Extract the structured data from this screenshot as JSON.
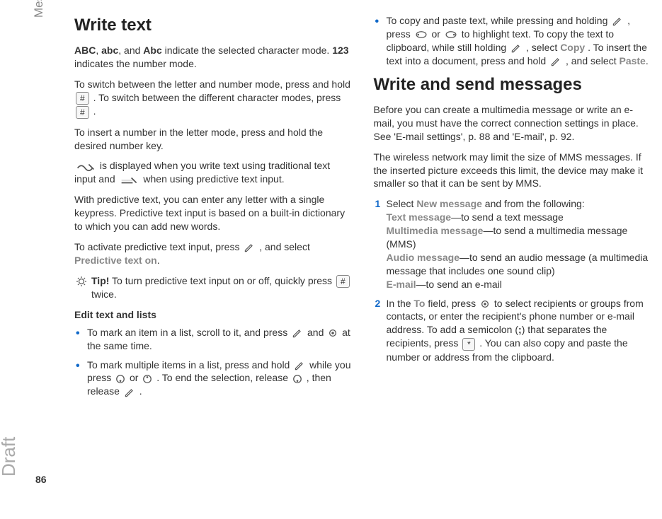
{
  "side": {
    "section": "Messaging",
    "watermark": "Draft",
    "page_number": "86"
  },
  "left": {
    "h1": "Write text",
    "p1_parts": {
      "abc_upper": "ABC",
      "sep1": ", ",
      "abc_lower": "abc",
      "sep2": ", and ",
      "abc_title": "Abc",
      "after": " indicate the selected character mode. ",
      "num": "123",
      "tail": " indicates the number mode."
    },
    "p2_before": "To switch between the letter and number mode, press and hold ",
    "p2_mid": ". To switch between the different character modes, press ",
    "p2_after": ".",
    "p3": "To insert a number in the letter mode, press and hold the desired number key.",
    "p4_before": " is displayed when you write text using traditional text input and ",
    "p4_after": " when using predictive text input.",
    "p5": "With predictive text, you can enter any letter with a single keypress. Predictive text input is based on a built-in dictionary to which you can add new words.",
    "p6_before": "To activate predictive text input, press ",
    "p6_mid": ", and select ",
    "p6_opt": "Predictive text on",
    "p6_after": ".",
    "tip_label": "Tip!",
    "tip_before": " To turn predictive text input on or off, quickly press ",
    "tip_after": " twice.",
    "subhead": "Edit text and lists",
    "b1_before": "To mark an item in a list, scroll to it, and press ",
    "b1_mid": " and ",
    "b1_after": " at the same time.",
    "b2_before": "To mark multiple items in a list, press and hold ",
    "b2_mid1": " while you press ",
    "b2_mid2": " or ",
    "b2_mid3": ". To end the selection, release ",
    "b2_mid4": ", then release ",
    "b2_after": "."
  },
  "right": {
    "b3_before": "To copy and paste text, while pressing and holding ",
    "b3_mid1": ", press ",
    "b3_mid2": " or ",
    "b3_mid3": " to highlight text. To copy the text to clipboard, while still holding ",
    "b3_mid4": ", select ",
    "b3_copy": "Copy",
    "b3_mid5": ". To insert the text into a document, press and hold ",
    "b3_mid6": ", and select ",
    "b3_paste": "Paste",
    "b3_after": ".",
    "h1": "Write and send messages",
    "p1": "Before you can create a multimedia message or write an e-mail, you must have the correct connection settings in place. See 'E-mail settings', p. 88 and 'E-mail', p. 92.",
    "p2": "The wireless network may limit the size of MMS messages. If the inserted picture exceeds this limit, the device may make it smaller so that it can be sent by MMS.",
    "s1_before": "Select ",
    "s1_newmsg": "New message",
    "s1_after": " and from the following:",
    "s1_opt1": "Text message",
    "s1_opt1_desc": "—to send a text message",
    "s1_opt2": "Multimedia message",
    "s1_opt2_desc": "—to send a multimedia message (MMS)",
    "s1_opt3": "Audio message",
    "s1_opt3_desc": "—to send an audio message (a multimedia message that includes one sound clip)",
    "s1_opt4": "E-mail",
    "s1_opt4_desc": "—to send an e-mail",
    "s2_before": "In the ",
    "s2_to": "To",
    "s2_mid1": " field, press ",
    "s2_mid2": " to select recipients or groups from contacts, or enter the recipient's phone number or e-mail address. To add a semicolon (",
    "s2_semi": ";",
    "s2_mid3": ") that separates the recipients, press ",
    "s2_after": ". You can also copy and paste the number or address from the clipboard."
  },
  "keys": {
    "hash": "#",
    "star": "*"
  }
}
